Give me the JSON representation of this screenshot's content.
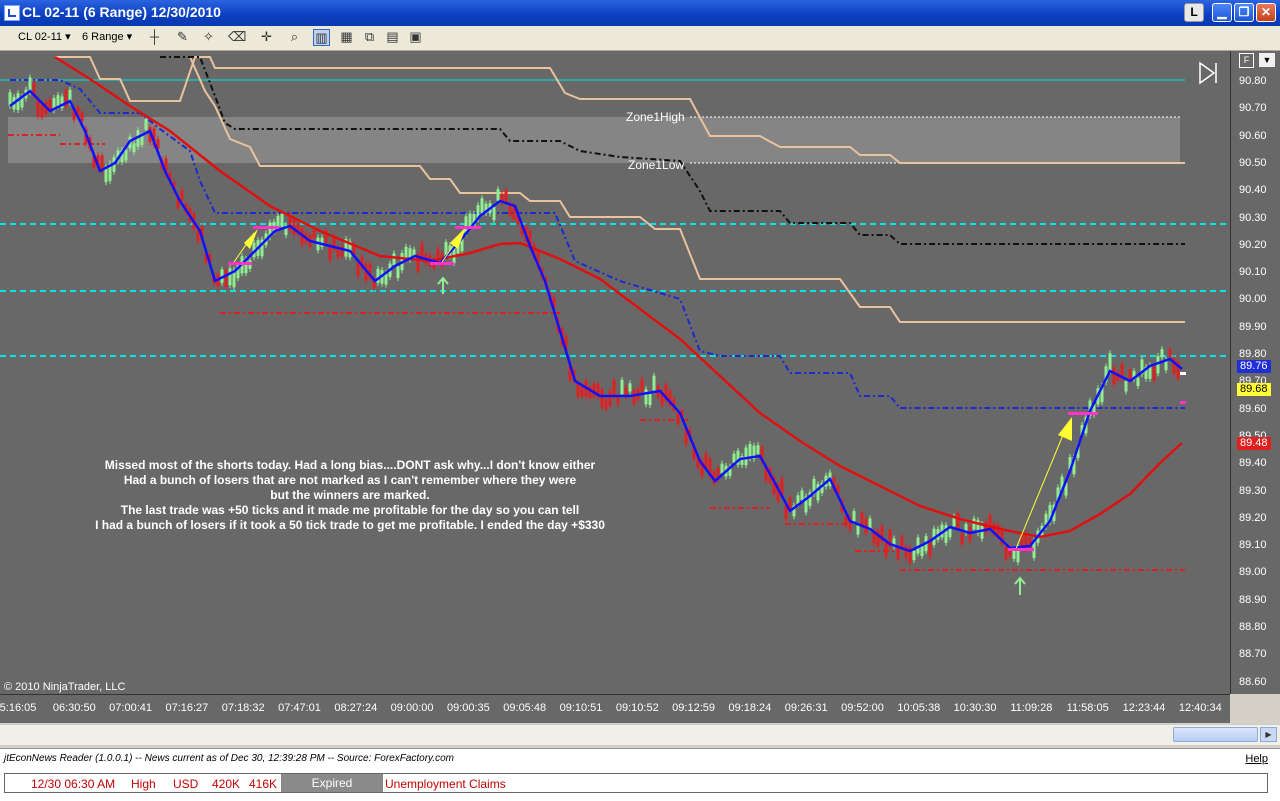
{
  "window": {
    "title": "CL 02-11 (6 Range)  12/30/2010",
    "buttons": {
      "l": "L",
      "minimize": "▁",
      "restore": "❐",
      "close": "✕"
    }
  },
  "toolbar": {
    "instrument": "CL 02-11",
    "period": "6 Range"
  },
  "chart": {
    "price_labels": [
      "90.80",
      "90.70",
      "90.60",
      "90.50",
      "90.40",
      "90.30",
      "90.20",
      "90.10",
      "90.00",
      "89.90",
      "89.80",
      "89.70",
      "89.60",
      "89.50",
      "89.40",
      "89.30",
      "89.20",
      "89.10",
      "89.00",
      "88.90",
      "88.80",
      "88.70",
      "88.60"
    ],
    "badges": [
      {
        "text": "89.76",
        "bg": "#1f2fd8",
        "fg": "#ffffff"
      },
      {
        "text": "89.68",
        "bg": "#ffff33",
        "fg": "#000000"
      },
      {
        "text": "89.48",
        "bg": "#e02020",
        "fg": "#ffffff"
      }
    ],
    "time_labels": [
      "5:16:05",
      "06:30:50",
      "07:00:41",
      "07:16:27",
      "07:18:32",
      "07:47:01",
      "08:27:24",
      "09:00:00",
      "09:00:35",
      "09:05:48",
      "09:10:51",
      "09:10:52",
      "09:12:59",
      "09:18:24",
      "09:26:31",
      "09:52:00",
      "10:05:38",
      "10:30:30",
      "11:09:28",
      "11:58:05",
      "12:23:44",
      "12:40:34"
    ],
    "zone_labels": {
      "high": "Zone1High",
      "low": "Zone1Low"
    },
    "copyright": "© 2010 NinjaTrader, LLC",
    "annotation": [
      "Missed most of the shorts today. Had a long bias....DONT ask why...I don't know either",
      "Had a bunch of losers that are not marked as I can't remember where they were",
      "but the winners are marked.",
      "The last trade was +50 ticks and it made me profitable for the day so you can tell",
      "I had a bunch of losers if it took a 50 tick trade to get me profitable. I ended the day +$330"
    ],
    "colors": {
      "background": "#686868",
      "up_bar": "#90ee90",
      "down_bar": "#e02020",
      "fast_ma": "#1010ff",
      "slow_ma": "#e01010",
      "cyan_line": "#00e5e5",
      "tan_line": "#e8c39e"
    }
  },
  "news": {
    "header": "jtEconNews Reader (1.0.0.1) -- News current as of Dec 30, 12:39:28 PM -- Source: ForexFactory.com",
    "help": "Help",
    "row": {
      "datetime": "12/30 06:30 AM",
      "impact": "High",
      "currency": "USD",
      "actual": "420K",
      "forecast": "416K",
      "status": "Expired",
      "event": "Unemployment Claims"
    }
  }
}
